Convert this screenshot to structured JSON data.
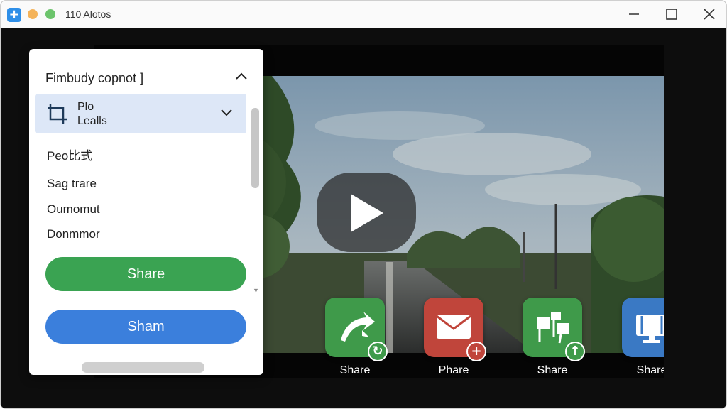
{
  "window": {
    "title": "110 Alotos"
  },
  "sidebar_panel": {
    "header": "Fimbudy copnot ]",
    "selected_item": {
      "line1": "Plo",
      "line2": "Lealls"
    },
    "items": [
      {
        "label": "Peo比式"
      },
      {
        "label": "Sag trare"
      },
      {
        "label": "Oumomut"
      },
      {
        "label": "Donmmor"
      }
    ],
    "buttons": {
      "green_label": "Share",
      "blue_label": "Sham"
    }
  },
  "share_targets": [
    {
      "label": "Share",
      "icon": "share-arrow-icon",
      "color": "#3f9a4a",
      "badge": "↻"
    },
    {
      "label": "Phare",
      "icon": "mail-icon",
      "color": "#c0453b",
      "badge": "+"
    },
    {
      "label": "Share",
      "icon": "flags-icon",
      "color": "#3f9a4a",
      "badge": "↑"
    },
    {
      "label": "Share",
      "icon": "package-icon",
      "color": "#3a79c4",
      "badge": "+"
    }
  ],
  "colors": {
    "accent_green": "#3aa352",
    "accent_blue": "#3b7fdc",
    "selection": "#dde7f7"
  }
}
